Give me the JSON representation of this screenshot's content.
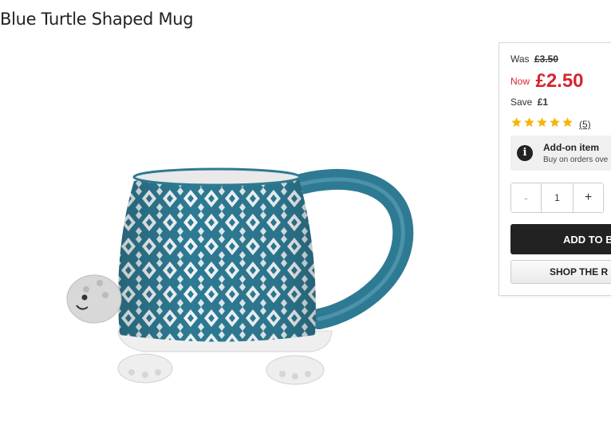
{
  "product": {
    "title": "Blue Turtle Shaped Mug",
    "image_alt": "Blue turtle shaped mug"
  },
  "pricing": {
    "was_label": "Was",
    "was_price": "£3.50",
    "now_label": "Now",
    "now_price": "£2.50",
    "save_label": "Save",
    "save_amount": "£1",
    "now_color": "#d22730"
  },
  "rating": {
    "stars": 5,
    "max_stars": 5,
    "review_count": "(5)",
    "star_color": "#f5b50a"
  },
  "addon": {
    "icon": "info-icon",
    "title": "Add-on item",
    "subtitle": "Buy on orders ove"
  },
  "quantity": {
    "minus_label": "-",
    "value": "1",
    "plus_label": "+"
  },
  "actions": {
    "add_to_bag_label": "ADD TO B",
    "shop_range_label": "SHOP THE R"
  },
  "colors": {
    "mug_blue": "#2e7a93",
    "button_dark": "#222222"
  }
}
